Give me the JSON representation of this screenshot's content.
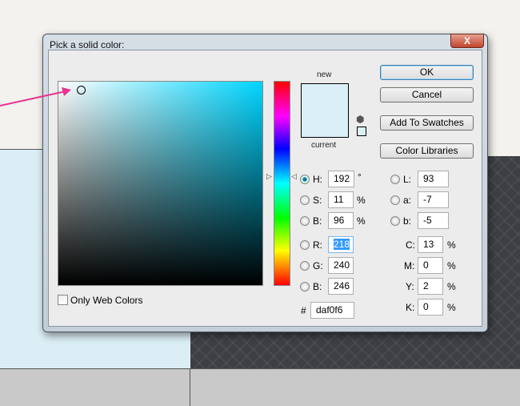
{
  "dialog": {
    "title": "Pick a solid color:",
    "close_label": "X"
  },
  "buttons": {
    "ok": "OK",
    "cancel": "Cancel",
    "add_to_swatches": "Add To Swatches",
    "color_libraries": "Color Libraries"
  },
  "swatch": {
    "new_label": "new",
    "current_label": "current",
    "new_color": "#daf0f6",
    "current_color": "#daf0f6"
  },
  "hsb": {
    "h_label": "H:",
    "h": "192",
    "h_unit": "°",
    "s_label": "S:",
    "s": "11",
    "s_unit": "%",
    "b_label": "B:",
    "b": "96",
    "b_unit": "%",
    "selected": "H"
  },
  "rgb": {
    "r_label": "R:",
    "r": "218",
    "g_label": "G:",
    "g": "240",
    "b_label": "B:",
    "b": "246"
  },
  "lab": {
    "l_label": "L:",
    "l": "93",
    "a_label": "a:",
    "a": "-7",
    "b_label": "b:",
    "b": "-5"
  },
  "cmyk": {
    "c_label": "C:",
    "c": "13",
    "m_label": "M:",
    "m": "0",
    "y_label": "Y:",
    "y": "2",
    "k_label": "K:",
    "k": "0",
    "unit": "%"
  },
  "hex": {
    "label": "#",
    "value": "daf0f6"
  },
  "only_web_colors": {
    "label": "Only Web Colors",
    "checked": false
  },
  "colors": {
    "arrow": "#e8338f",
    "hue_base": "#00d5ff"
  }
}
